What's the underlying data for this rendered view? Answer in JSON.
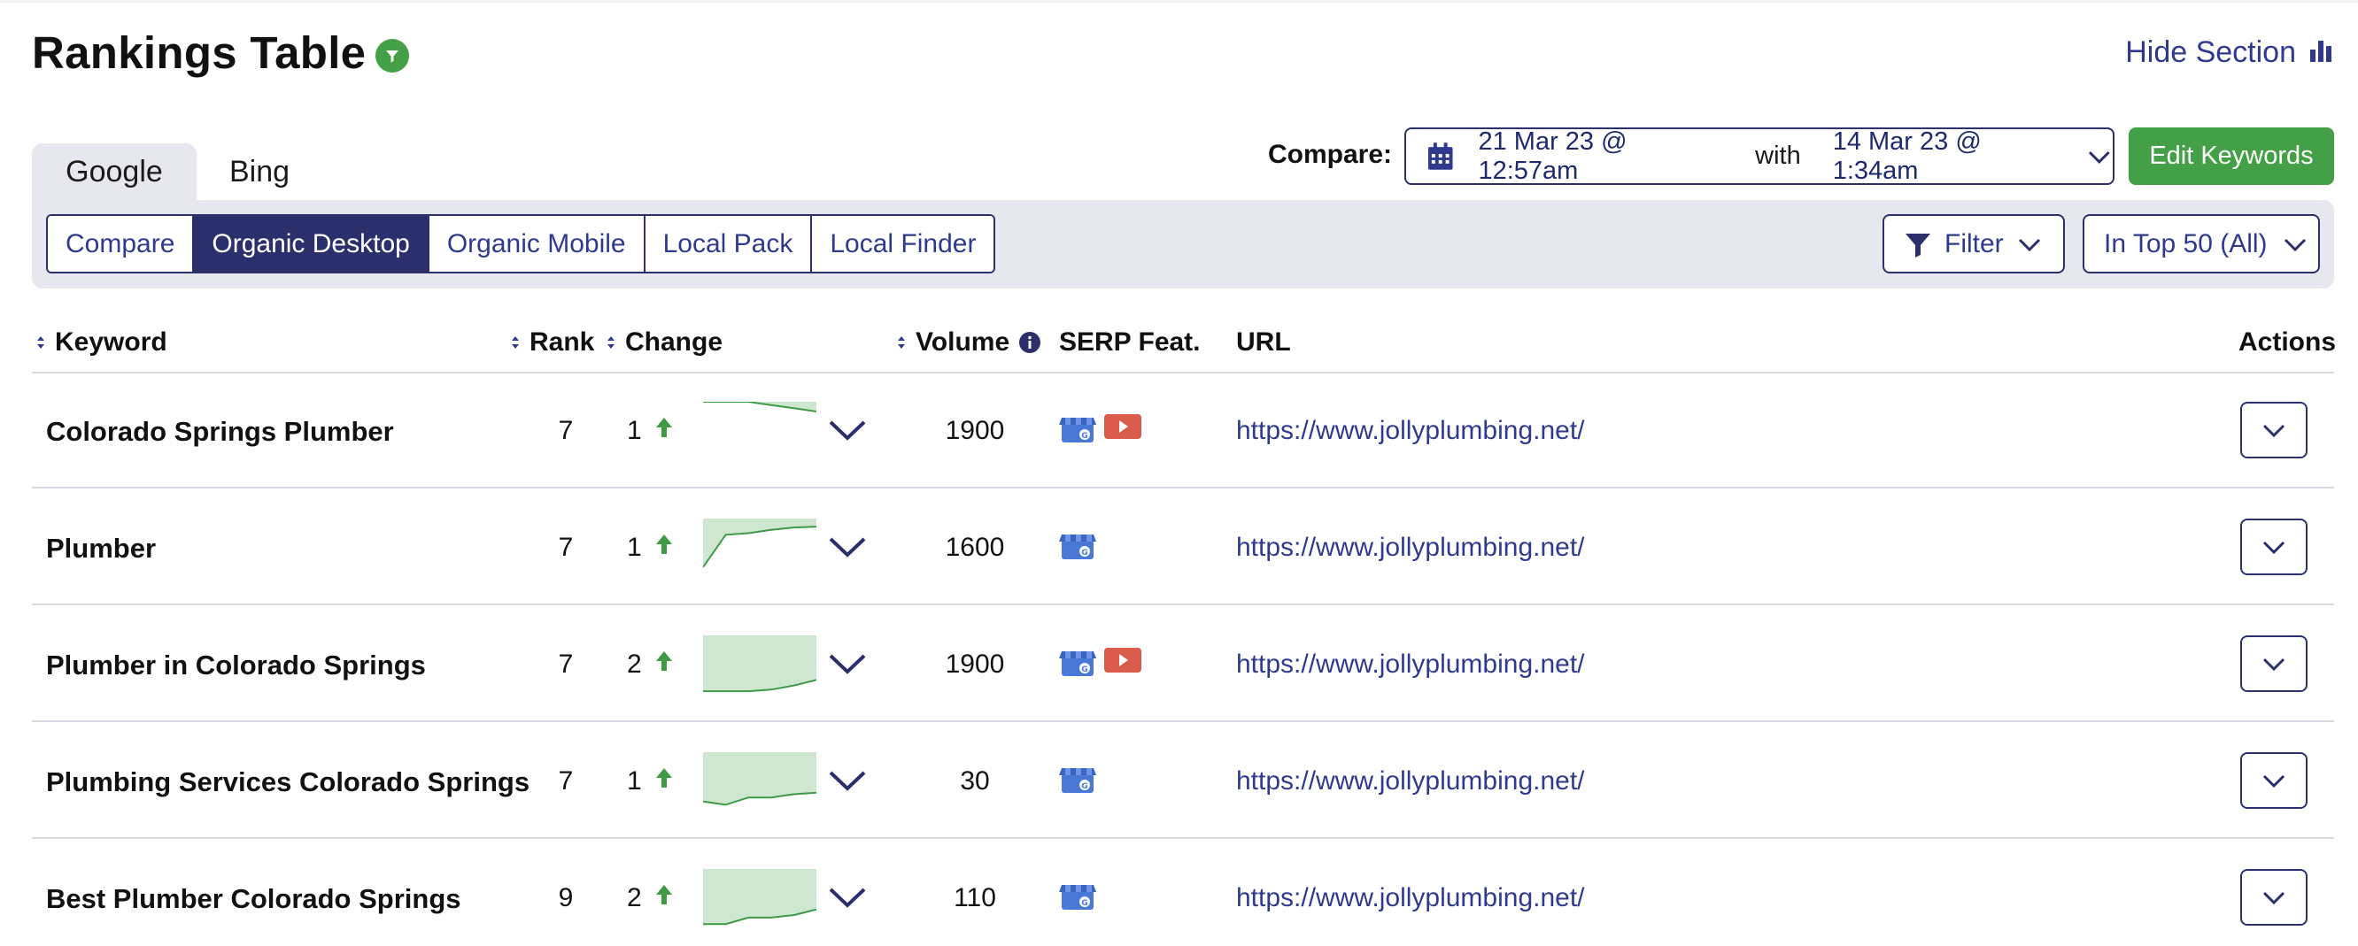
{
  "header": {
    "title": "Rankings Table",
    "hide_section": "Hide Section"
  },
  "engine_tabs": [
    {
      "label": "Google",
      "active": true
    },
    {
      "label": "Bing",
      "active": false
    }
  ],
  "compare": {
    "label": "Compare:",
    "date_from": "21 Mar 23 @ 12:57am",
    "with_label": "with",
    "date_to": "14 Mar 23 @ 1:34am",
    "edit_keywords": "Edit Keywords"
  },
  "views": [
    {
      "label": "Compare",
      "active": false
    },
    {
      "label": "Organic Desktop",
      "active": true
    },
    {
      "label": "Organic Mobile",
      "active": false
    },
    {
      "label": "Local Pack",
      "active": false
    },
    {
      "label": "Local Finder",
      "active": false
    }
  ],
  "filter": {
    "label": "Filter"
  },
  "range_select": {
    "label": "In Top 50 (All)"
  },
  "columns": {
    "keyword": "Keyword",
    "rank": "Rank",
    "change": "Change",
    "volume": "Volume",
    "serp": "SERP Feat.",
    "url": "URL",
    "actions": "Actions"
  },
  "rows": [
    {
      "keyword": "Colorado Springs Plumber",
      "rank": "7",
      "change": "1",
      "trend": [
        7,
        7,
        7,
        6.6,
        6.2,
        5.8
      ],
      "volume": "1900",
      "serp": [
        "local-pack-icon",
        "video-icon"
      ],
      "url": "https://www.jollyplumbing.net/"
    },
    {
      "keyword": "Plumber",
      "rank": "7",
      "change": "1",
      "trend": [
        1,
        5,
        5.2,
        5.6,
        5.9,
        6
      ],
      "volume": "1600",
      "serp": [
        "local-pack-icon"
      ],
      "url": "https://www.jollyplumbing.net/"
    },
    {
      "keyword": "Plumber in Colorado Springs",
      "rank": "7",
      "change": "2",
      "trend": [
        0.1,
        0.1,
        0.1,
        0.3,
        0.8,
        1.5
      ],
      "volume": "1900",
      "serp": [
        "local-pack-icon",
        "video-icon"
      ],
      "url": "https://www.jollyplumbing.net/"
    },
    {
      "keyword": "Plumbing Services Colorado Springs",
      "rank": "7",
      "change": "1",
      "trend": [
        0.9,
        0.5,
        1.4,
        1.4,
        1.8,
        2
      ],
      "volume": "30",
      "serp": [
        "local-pack-icon"
      ],
      "url": "https://www.jollyplumbing.net/"
    },
    {
      "keyword": "Best Plumber Colorado Springs",
      "rank": "9",
      "change": "2",
      "trend": [
        0.2,
        0.2,
        1,
        1,
        1.3,
        2
      ],
      "volume": "110",
      "serp": [
        "local-pack-icon"
      ],
      "url": "https://www.jollyplumbing.net/"
    }
  ],
  "colors": {
    "navy": "#2b2f6b",
    "link": "#2f3a8f",
    "green": "#43a047",
    "spark_fill": "#cfe7d0",
    "spark_line": "#3f9a45",
    "panel": "#e6e7ef"
  }
}
